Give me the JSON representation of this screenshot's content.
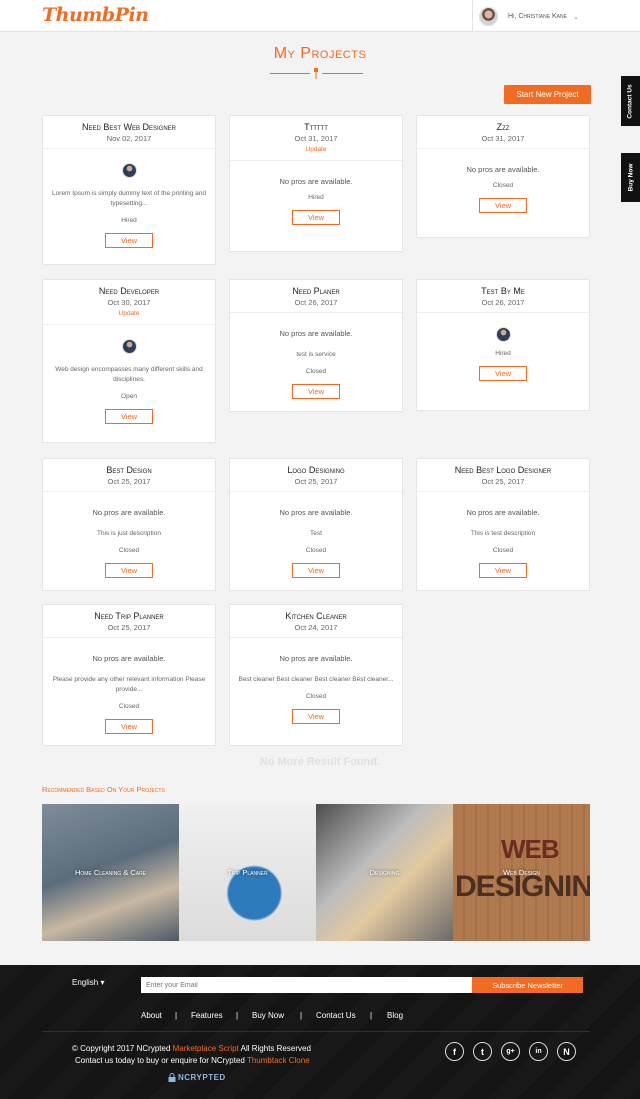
{
  "header": {
    "logo": "ThumbPin",
    "greeting": "Hi, Christiane Kane"
  },
  "side_tabs": {
    "contact": "Contact Us",
    "buy": "Buy Now"
  },
  "page": {
    "title": "My Projects",
    "start_button": "Start New Project",
    "no_more": "No More Result Found."
  },
  "cards": [
    {
      "title": "Need Best Web Designer",
      "date": "Nov 02, 2017",
      "update": "",
      "avatar": true,
      "nopros": "",
      "desc": "Lorem Ipsum is simply dummy text of the printing and typesetting...",
      "extra": "",
      "status": "Hired",
      "view": "View"
    },
    {
      "title": "Tttttt",
      "date": "Oct 31, 2017",
      "update": "Update",
      "avatar": false,
      "nopros": "No pros are available.",
      "desc": "",
      "extra": "",
      "status": "Hired",
      "view": "View"
    },
    {
      "title": "Zzz",
      "date": "Oct 31, 2017",
      "update": "",
      "avatar": false,
      "nopros": "No pros are available.",
      "desc": "",
      "extra": "",
      "status": "Closed",
      "view": "View"
    },
    {
      "title": "Need Developer",
      "date": "Oct 30, 2017",
      "update": "Update",
      "avatar": true,
      "nopros": "",
      "desc": "Web design encompasses many different skills and disciplines.",
      "extra": "",
      "status": "Open",
      "view": "View"
    },
    {
      "title": "Need Planer",
      "date": "Oct 26, 2017",
      "update": "",
      "avatar": false,
      "nopros": "No pros are available.",
      "desc": "",
      "extra": "test is service",
      "status": "Closed",
      "view": "View"
    },
    {
      "title": "Test By Me",
      "date": "Oct 26, 2017",
      "update": "",
      "avatar": true,
      "nopros": "",
      "desc": "",
      "extra": "",
      "status": "Hired",
      "view": "View"
    },
    {
      "title": "Best Design",
      "date": "Oct 25, 2017",
      "update": "",
      "avatar": false,
      "nopros": "No pros are available.",
      "desc": "",
      "extra": "This is just description",
      "status": "Closed",
      "view": "View"
    },
    {
      "title": "Logo Designing",
      "date": "Oct 25, 2017",
      "update": "",
      "avatar": false,
      "nopros": "No pros are available.",
      "desc": "",
      "extra": "Test",
      "status": "Closed",
      "view": "View"
    },
    {
      "title": "Need Best Logo Designer",
      "date": "Oct 25, 2017",
      "update": "",
      "avatar": false,
      "nopros": "No pros are available.",
      "desc": "",
      "extra": "This is test description",
      "status": "Closed",
      "view": "View"
    },
    {
      "title": "Need Trip Planner",
      "date": "Oct 25, 2017",
      "update": "",
      "avatar": false,
      "nopros": "No pros are available.",
      "desc": "",
      "extra": "Please provide any other relevant information Please provide...",
      "status": "Closed",
      "view": "View"
    },
    {
      "title": "Kitchen Cleaner",
      "date": "Oct 24, 2017",
      "update": "",
      "avatar": false,
      "nopros": "No pros are available.",
      "desc": "",
      "extra": "Best cleaner Best cleaner Best cleaner Best cleaner...",
      "status": "Closed",
      "view": "View"
    }
  ],
  "recommended": {
    "title": "Recommended Based On Your Projects",
    "tiles": [
      "Home Cleaning & Care",
      "Trip Planner",
      "Designing",
      "Web Design"
    ],
    "tile_art": {
      "web": "WEB",
      "designing": "DESIGNING"
    }
  },
  "footer": {
    "language": "English",
    "email_placeholder": "Enter your Email",
    "subscribe": "Subscribe Newsletter",
    "nav": [
      "About",
      "Features",
      "Buy Now",
      "Contact Us",
      "Blog"
    ],
    "sep": "|",
    "copy1_a": "© Copyright 2017 NCrypted ",
    "copy1_b": "Marketplace Script",
    "copy1_c": " All Rights Reserved",
    "copy2_a": "Contact us today to buy or enquire for NCrypted ",
    "copy2_b": "Thumbtack Clone",
    "social": [
      "f",
      "t",
      "g+",
      "in",
      "N"
    ],
    "ncrypted_logo": "NCRYPTED"
  },
  "colors": {
    "accent": "#f26b22",
    "footer_bg": "#141414"
  }
}
